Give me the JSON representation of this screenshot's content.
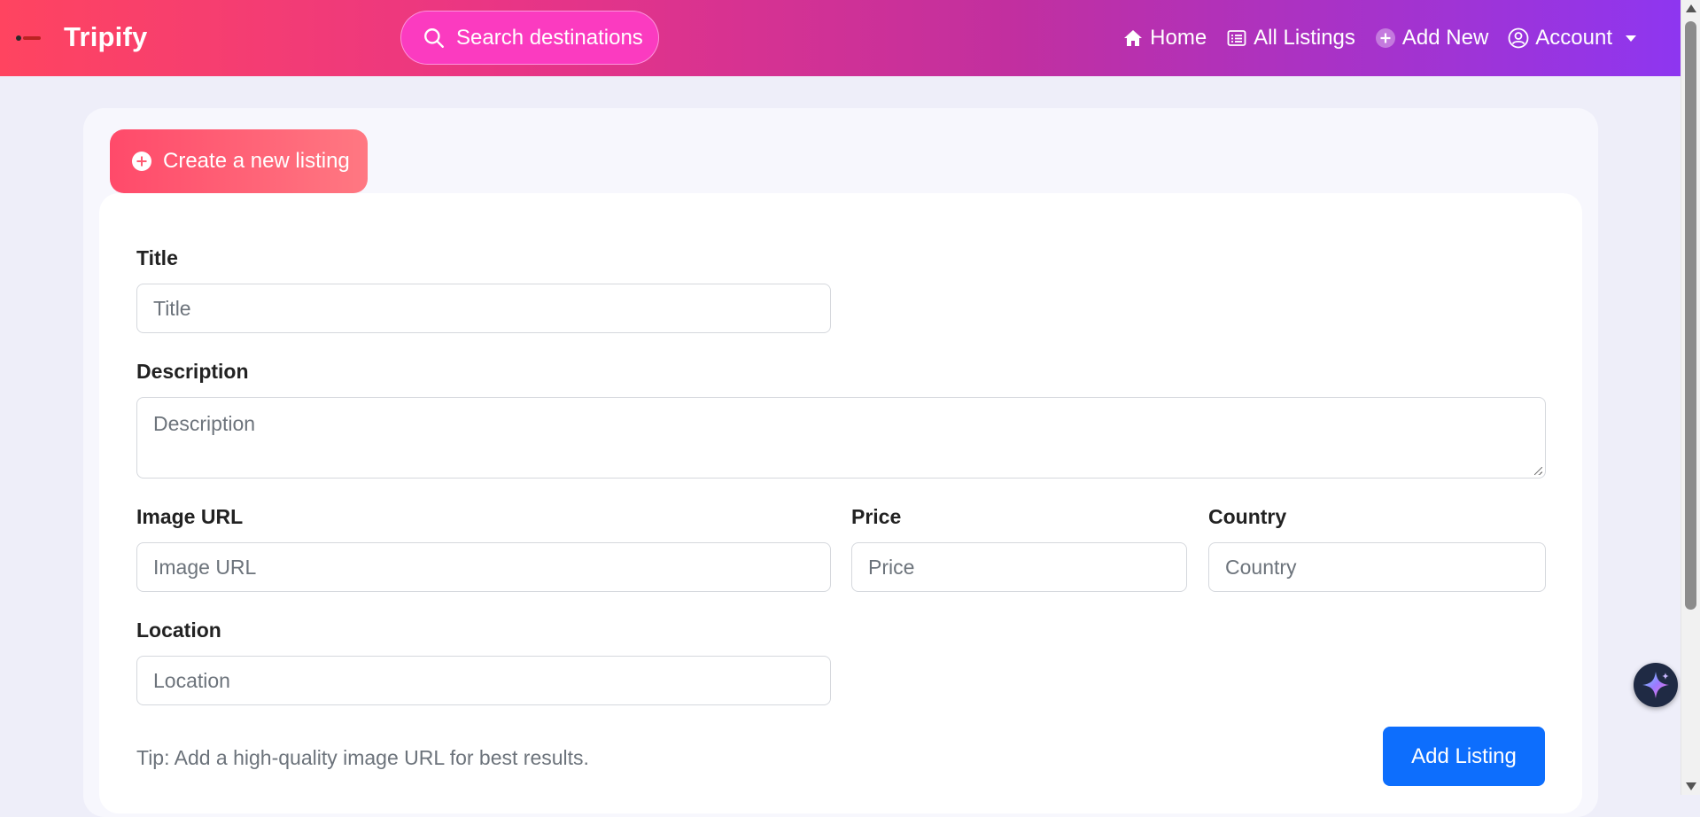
{
  "header": {
    "brand": "Tripify",
    "search_label": "Search destinations",
    "nav": {
      "home": "Home",
      "all_listings": "All Listings",
      "add_new": "Add New",
      "account": "Account"
    }
  },
  "form": {
    "tab_label": "Create a new listing",
    "fields": {
      "title": {
        "label": "Title",
        "placeholder": "Title"
      },
      "description": {
        "label": "Description",
        "placeholder": "Description"
      },
      "image_url": {
        "label": "Image URL",
        "placeholder": "Image URL"
      },
      "price": {
        "label": "Price",
        "placeholder": "Price"
      },
      "country": {
        "label": "Country",
        "placeholder": "Country"
      },
      "location": {
        "label": "Location",
        "placeholder": "Location"
      }
    },
    "tip": "Tip: Add a high-quality image URL for best results.",
    "submit_label": "Add Listing"
  },
  "colors": {
    "accent": "#0d6efd",
    "nav_gradient_start": "#ff4460",
    "nav_gradient_end": "#8e36f0"
  },
  "icons": [
    "logo",
    "search-icon",
    "home-icon",
    "list-icon",
    "plus-circle-icon",
    "user-circle-icon",
    "chevron-down-icon",
    "sparkle-icon"
  ]
}
